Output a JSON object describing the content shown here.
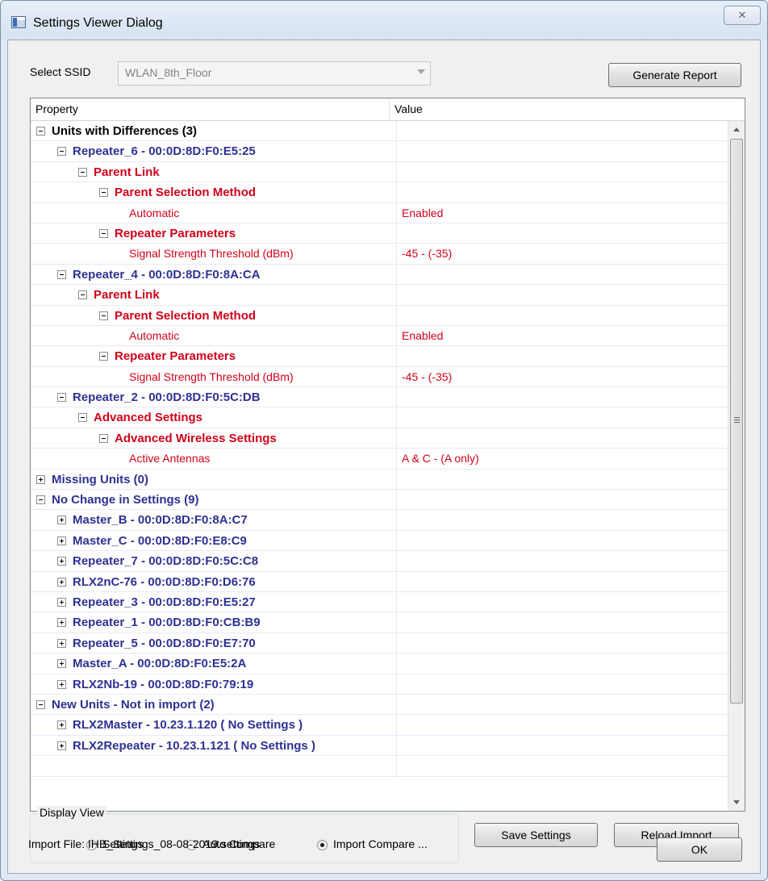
{
  "window": {
    "title": "Settings Viewer Dialog",
    "close_glyph": "✕"
  },
  "ssid": {
    "label": "Select SSID",
    "value": "WLAN_8th_Floor"
  },
  "buttons": {
    "generate_report": "Generate Report",
    "save_settings": "Save Settings",
    "reload_import": "Reload Import",
    "ok": "OK"
  },
  "tree": {
    "columns": [
      "Property",
      "Value"
    ],
    "rows": [
      {
        "level": 0,
        "expander": "minus",
        "name": "Units with Differences (3)",
        "value": "",
        "style": "group"
      },
      {
        "level": 1,
        "expander": "minus",
        "name": "Repeater_6 - 00:0D:8D:F0:E5:25",
        "value": "",
        "style": "unit"
      },
      {
        "level": 2,
        "expander": "minus",
        "name": "Parent Link",
        "value": "",
        "style": "section"
      },
      {
        "level": 3,
        "expander": "minus",
        "name": "Parent Selection Method",
        "value": "",
        "style": "section"
      },
      {
        "level": 4,
        "expander": "",
        "name": "Automatic",
        "value": "Enabled",
        "style": "leaf"
      },
      {
        "level": 3,
        "expander": "minus",
        "name": "Repeater Parameters",
        "value": "",
        "style": "section"
      },
      {
        "level": 4,
        "expander": "",
        "name": "Signal Strength Threshold (dBm)",
        "value": "-45 - (-35)",
        "style": "leaf"
      },
      {
        "level": 1,
        "expander": "minus",
        "name": "Repeater_4 - 00:0D:8D:F0:8A:CA",
        "value": "",
        "style": "unit"
      },
      {
        "level": 2,
        "expander": "minus",
        "name": "Parent Link",
        "value": "",
        "style": "section"
      },
      {
        "level": 3,
        "expander": "minus",
        "name": "Parent Selection Method",
        "value": "",
        "style": "section"
      },
      {
        "level": 4,
        "expander": "",
        "name": "Automatic",
        "value": "Enabled",
        "style": "leaf"
      },
      {
        "level": 3,
        "expander": "minus",
        "name": "Repeater Parameters",
        "value": "",
        "style": "section"
      },
      {
        "level": 4,
        "expander": "",
        "name": "Signal Strength Threshold (dBm)",
        "value": "-45 - (-35)",
        "style": "leaf"
      },
      {
        "level": 1,
        "expander": "minus",
        "name": "Repeater_2 - 00:0D:8D:F0:5C:DB",
        "value": "",
        "style": "unit"
      },
      {
        "level": 2,
        "expander": "minus",
        "name": "Advanced Settings",
        "value": "",
        "style": "section"
      },
      {
        "level": 3,
        "expander": "minus",
        "name": "Advanced Wireless Settings",
        "value": "",
        "style": "section"
      },
      {
        "level": 4,
        "expander": "",
        "name": "Active Antennas",
        "value": "A & C - (A only)",
        "style": "leaf"
      },
      {
        "level": 0,
        "expander": "plus",
        "name": "Missing Units (0)",
        "value": "",
        "style": "unit"
      },
      {
        "level": 0,
        "expander": "minus",
        "name": "No Change in Settings (9)",
        "value": "",
        "style": "unit"
      },
      {
        "level": 1,
        "expander": "plus",
        "name": "Master_B - 00:0D:8D:F0:8A:C7",
        "value": "",
        "style": "unit"
      },
      {
        "level": 1,
        "expander": "plus",
        "name": "Master_C - 00:0D:8D:F0:E8:C9",
        "value": "",
        "style": "unit"
      },
      {
        "level": 1,
        "expander": "plus",
        "name": "Repeater_7 - 00:0D:8D:F0:5C:C8",
        "value": "",
        "style": "unit"
      },
      {
        "level": 1,
        "expander": "plus",
        "name": "RLX2nC-76 - 00:0D:8D:F0:D6:76",
        "value": "",
        "style": "unit"
      },
      {
        "level": 1,
        "expander": "plus",
        "name": "Repeater_3 - 00:0D:8D:F0:E5:27",
        "value": "",
        "style": "unit"
      },
      {
        "level": 1,
        "expander": "plus",
        "name": "Repeater_1 - 00:0D:8D:F0:CB:B9",
        "value": "",
        "style": "unit"
      },
      {
        "level": 1,
        "expander": "plus",
        "name": "Repeater_5 - 00:0D:8D:F0:E7:70",
        "value": "",
        "style": "unit"
      },
      {
        "level": 1,
        "expander": "plus",
        "name": "Master_A - 00:0D:8D:F0:E5:2A",
        "value": "",
        "style": "unit"
      },
      {
        "level": 1,
        "expander": "plus",
        "name": "RLX2Nb-19 - 00:0D:8D:F0:79:19",
        "value": "",
        "style": "unit"
      },
      {
        "level": 0,
        "expander": "minus",
        "name": "New Units - Not in import (2)",
        "value": "",
        "style": "unit"
      },
      {
        "level": 1,
        "expander": "plus",
        "name": "RLX2Master - 10.23.1.120  ( No Settings )",
        "value": "",
        "style": "unit"
      },
      {
        "level": 1,
        "expander": "plus",
        "name": "RLX2Repeater - 10.23.1.121  ( No Settings )",
        "value": "",
        "style": "unit"
      },
      {
        "level": 0,
        "expander": "",
        "name": "",
        "value": "",
        "style": "empty"
      }
    ]
  },
  "display_view": {
    "title": "Display View",
    "options": [
      {
        "label": "Settings",
        "selected": false
      },
      {
        "label": "Auto Compare",
        "selected": false
      },
      {
        "label": "Import Compare ...",
        "selected": true
      }
    ]
  },
  "import_file": "Import File: IHB_Settings_08-08-2019.settings",
  "colors": {
    "unit_blue": "#2e3192",
    "diff_red": "#d0021b",
    "window_frame": "#dfe8f3",
    "dialog_face": "#f0f0f0"
  }
}
